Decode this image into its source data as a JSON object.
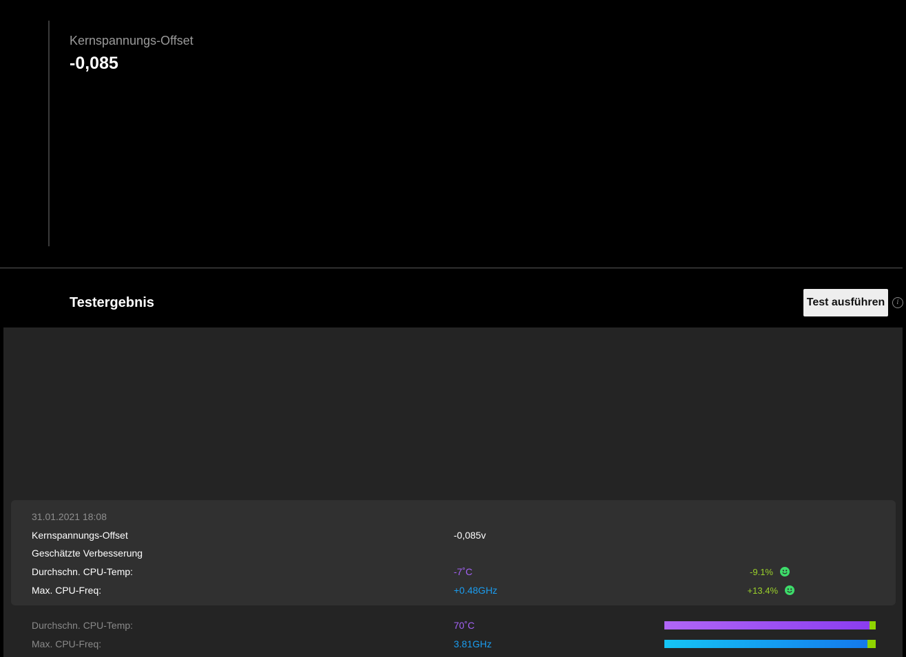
{
  "offset": {
    "label": "Kernspannungs-Offset",
    "value": "-0,085"
  },
  "results": {
    "title": "Testergebnis",
    "run_button": "Test ausführen",
    "info_icon": "info-icon",
    "card": {
      "date": "31.01.2021 18:08",
      "offset_label": "Kernspannungs-Offset",
      "offset_value": "-0,085v",
      "improvement_label": "Geschätzte Verbesserung",
      "temp_label": "Durchschn. CPU-Temp:",
      "temp_delta": "-7˚C",
      "temp_pct": "-9.1%",
      "freq_label": "Max. CPU-Freq:",
      "freq_delta": "+0.48GHz",
      "freq_pct": "+13.4%"
    },
    "summary": {
      "temp_label": "Durchschn. CPU-Temp:",
      "temp_value": "70˚C",
      "temp_bar_fraction": 0.97,
      "freq_label": "Max. CPU-Freq:",
      "freq_value": "3.81GHz",
      "freq_bar_fraction": 0.96
    }
  },
  "colors": {
    "temp": "#a362f5",
    "freq": "#1a9df0",
    "positive": "#9bd22a",
    "smiley": "#3ddc6a"
  }
}
